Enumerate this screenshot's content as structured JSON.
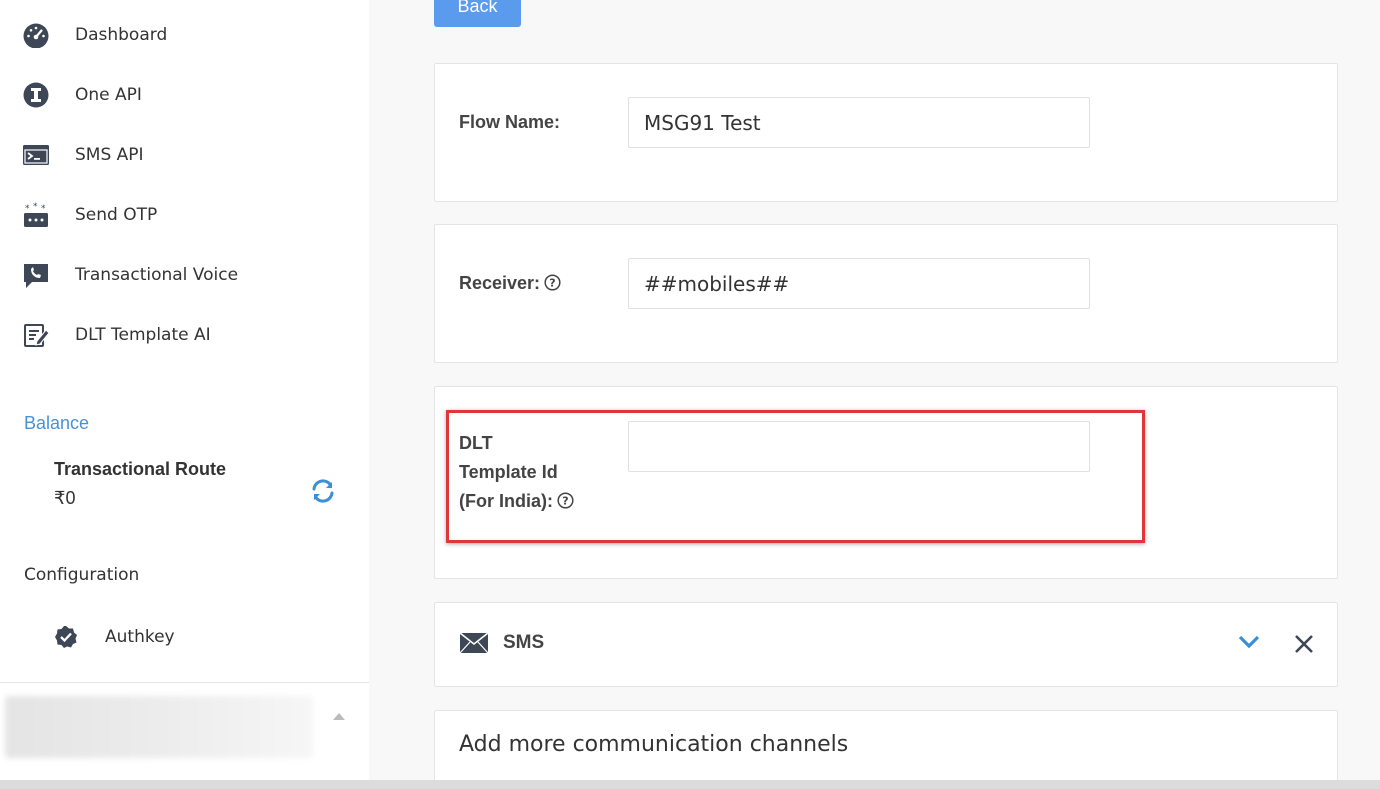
{
  "sidebar": {
    "nav": [
      {
        "label": "Dashboard",
        "icon": "dashboard-icon"
      },
      {
        "label": "One API",
        "icon": "one-api-icon"
      },
      {
        "label": "SMS API",
        "icon": "terminal-icon"
      },
      {
        "label": "Send OTP",
        "icon": "otp-icon"
      },
      {
        "label": "Transactional Voice",
        "icon": "voice-icon"
      },
      {
        "label": "DLT Template AI",
        "icon": "template-edit-icon"
      }
    ],
    "balance": {
      "title": "Balance",
      "route_name": "Transactional Route",
      "amount": "₹0"
    },
    "configuration": {
      "title": "Configuration",
      "authkey_label": "Authkey"
    }
  },
  "main": {
    "back_label": "Back",
    "flow_name": {
      "label": "Flow Name:",
      "value": "MSG91 Test"
    },
    "receiver": {
      "label": "Receiver:",
      "value": "##mobiles##"
    },
    "dlt": {
      "label_line1": "DLT",
      "label_line2": "Template Id",
      "label_line3": "(For India):",
      "value": ""
    },
    "sms_channel": {
      "label": "SMS"
    },
    "add_channels": {
      "title": "Add more communication channels"
    }
  },
  "colors": {
    "accent_blue": "#4a90d9",
    "button_blue": "#5b9bee",
    "highlight_red": "#e0353b",
    "icon_dark": "#3d4756"
  }
}
